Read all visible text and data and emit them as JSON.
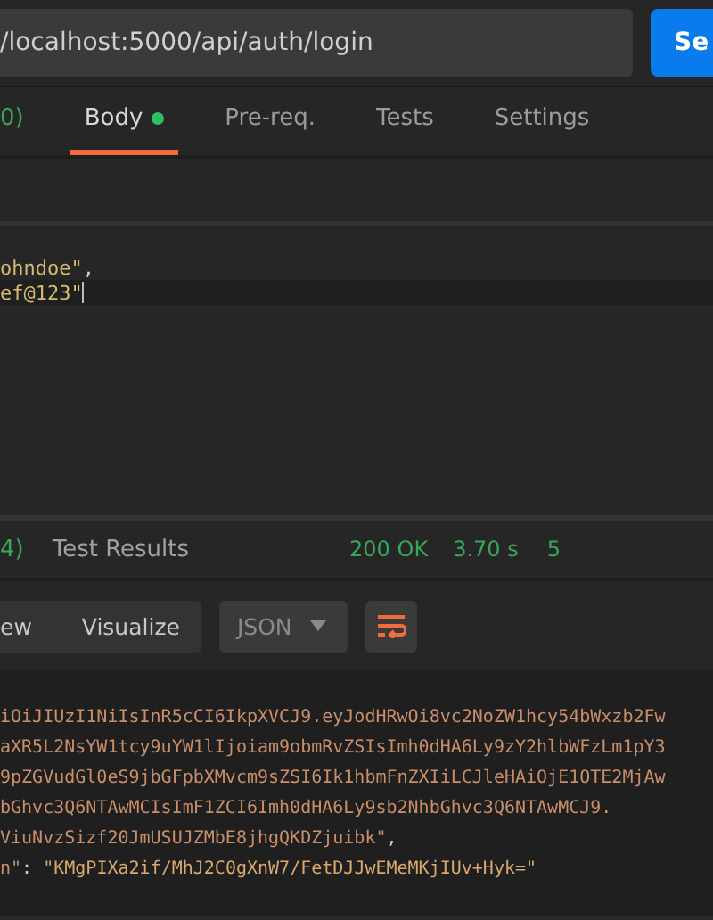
{
  "request": {
    "url": "/localhost:5000/api/auth/login",
    "send_label": "Se",
    "tabs": [
      {
        "label": "0)",
        "kind": "count",
        "selected": false,
        "dot": false
      },
      {
        "label": "Body",
        "kind": "tab",
        "selected": true,
        "dot": true
      },
      {
        "label": "Pre-req.",
        "kind": "tab",
        "selected": false,
        "dot": false
      },
      {
        "label": "Tests",
        "kind": "tab",
        "selected": false,
        "dot": false
      },
      {
        "label": "Settings",
        "kind": "tab",
        "selected": false,
        "dot": false
      }
    ],
    "body_lines": [
      {
        "current": false,
        "tokens": [
          {
            "text": "ohndoe\"",
            "kind": "string"
          },
          {
            "text": ",",
            "kind": "punct"
          }
        ]
      },
      {
        "current": true,
        "tokens": [
          {
            "text": "ef@123\"",
            "kind": "string"
          }
        ]
      }
    ]
  },
  "response": {
    "tabs": [
      {
        "label": "4)",
        "kind": "count",
        "selected": false
      },
      {
        "label": "Test Results",
        "kind": "tab",
        "selected": false
      }
    ],
    "status": "200 OK",
    "time": "3.70 s",
    "size": "5",
    "views": [
      {
        "label": "ew",
        "selected": false
      },
      {
        "label": "Visualize",
        "selected": false
      }
    ],
    "format": "JSON",
    "wrap_on": true,
    "lines": [
      {
        "tokens": [
          {
            "text": "iOiJIUzI1NiIsInR5cCI6IkpXVCJ9.eyJodHRwOi8vc2NoZW1hcy54bWxzb2Fw",
            "kind": "string"
          }
        ]
      },
      {
        "tokens": [
          {
            "text": "aXR5L2NsYW1tcy9uYW1lIjoiam9obmRvZSIsImh0dHA6Ly9zY2hlbWFzLm1pY3",
            "kind": "string"
          }
        ]
      },
      {
        "tokens": [
          {
            "text": "9pZGVudGl0eS9jbGFpbXMvcm9sZSI6Ik1hbmFnZXIiLCJleHAiOjE1OTE2MjAw",
            "kind": "string"
          }
        ]
      },
      {
        "tokens": [
          {
            "text": "bGhvc3Q6NTAwMCIsImF1ZCI6Imh0dHA6Ly9sb2NhbGhvc3Q6NTAwMCJ9.",
            "kind": "string"
          }
        ]
      },
      {
        "tokens": [
          {
            "text": "ViuNvzSizf20JmUSUJZMbE8jhgQKDZjuibk\"",
            "kind": "string"
          },
          {
            "text": ",",
            "kind": "punct"
          }
        ]
      },
      {
        "tokens": [
          {
            "text": "n\"",
            "kind": "key"
          },
          {
            "text": ": ",
            "kind": "punct"
          },
          {
            "text": "\"KMgPIXa2if/MhJ2C0gXnW7/FetDJJwEMeMKjIUv+Hyk=\"",
            "kind": "value"
          }
        ]
      }
    ]
  }
}
